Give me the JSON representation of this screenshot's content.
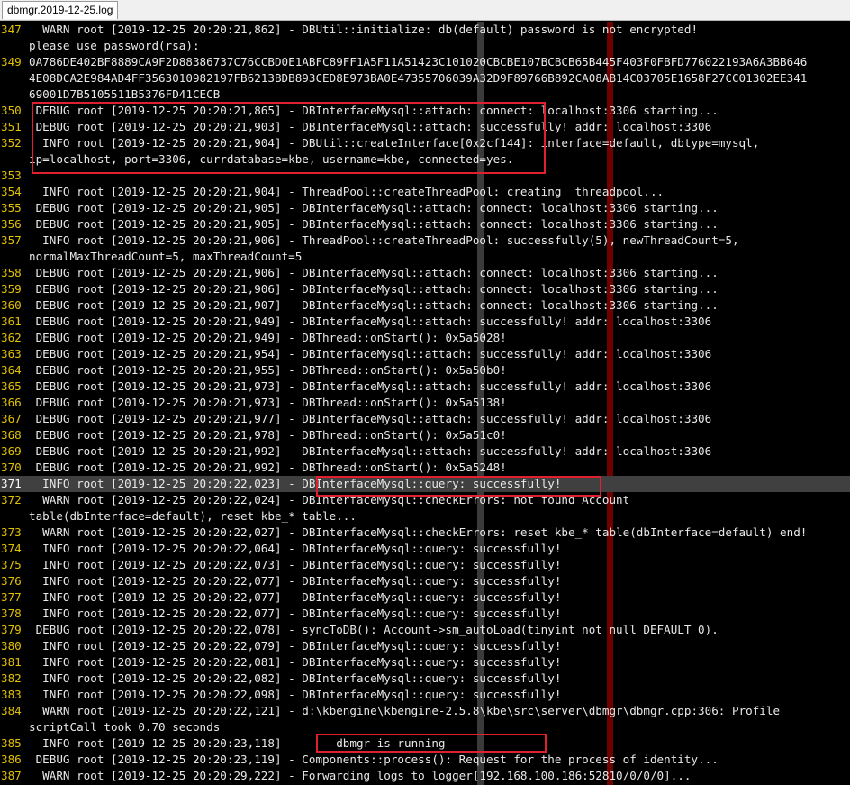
{
  "tab": {
    "title": "dbmgr.2019-12-25.log"
  },
  "lines": [
    {
      "no": "347",
      "text": "  WARN root [2019-12-25 20:20:21,862] - DBUtil::initialize: db(default) password is not encrypted!"
    },
    {
      "no": "",
      "text": "please use password(rsa):"
    },
    {
      "no": "349",
      "text": "0A786DE402BF8889CA9F2D88386737C76CCBD0E1ABFC89FF1A5F11A51423C101020CBCBE107BCBCB65B445F403F0FBFD776022193A6A3BB646"
    },
    {
      "no": "",
      "text": "4E08DCA2E984AD4FF3563010982197FB6213BDB893CED8E973BA0E47355706039A32D9F89766B892CA08AB14C03705E1658F27CC01302EE341"
    },
    {
      "no": "",
      "text": "69001D7B5105511B5376FD41CECB"
    },
    {
      "no": "350",
      "text": " DEBUG root [2019-12-25 20:20:21,865] - DBInterfaceMysql::attach: connect: localhost:3306 starting..."
    },
    {
      "no": "351",
      "text": " DEBUG root [2019-12-25 20:20:21,903] - DBInterfaceMysql::attach: successfully! addr: localhost:3306"
    },
    {
      "no": "352",
      "text": "  INFO root [2019-12-25 20:20:21,904] - DBUtil::createInterface[0x2cf144]: interface=default, dbtype=mysql,"
    },
    {
      "no": "",
      "text": "ip=localhost, port=3306, currdatabase=kbe, username=kbe, connected=yes."
    },
    {
      "no": "353",
      "text": ""
    },
    {
      "no": "354",
      "text": "  INFO root [2019-12-25 20:20:21,904] - ThreadPool::createThreadPool: creating  threadpool..."
    },
    {
      "no": "355",
      "text": " DEBUG root [2019-12-25 20:20:21,905] - DBInterfaceMysql::attach: connect: localhost:3306 starting..."
    },
    {
      "no": "356",
      "text": " DEBUG root [2019-12-25 20:20:21,905] - DBInterfaceMysql::attach: connect: localhost:3306 starting..."
    },
    {
      "no": "357",
      "text": "  INFO root [2019-12-25 20:20:21,906] - ThreadPool::createThreadPool: successfully(5), newThreadCount=5,"
    },
    {
      "no": "",
      "text": "normalMaxThreadCount=5, maxThreadCount=5"
    },
    {
      "no": "358",
      "text": " DEBUG root [2019-12-25 20:20:21,906] - DBInterfaceMysql::attach: connect: localhost:3306 starting..."
    },
    {
      "no": "359",
      "text": " DEBUG root [2019-12-25 20:20:21,906] - DBInterfaceMysql::attach: connect: localhost:3306 starting..."
    },
    {
      "no": "360",
      "text": " DEBUG root [2019-12-25 20:20:21,907] - DBInterfaceMysql::attach: connect: localhost:3306 starting..."
    },
    {
      "no": "361",
      "text": " DEBUG root [2019-12-25 20:20:21,949] - DBInterfaceMysql::attach: successfully! addr: localhost:3306"
    },
    {
      "no": "362",
      "text": " DEBUG root [2019-12-25 20:20:21,949] - DBThread::onStart(): 0x5a5028!"
    },
    {
      "no": "363",
      "text": " DEBUG root [2019-12-25 20:20:21,954] - DBInterfaceMysql::attach: successfully! addr: localhost:3306"
    },
    {
      "no": "364",
      "text": " DEBUG root [2019-12-25 20:20:21,955] - DBThread::onStart(): 0x5a50b0!"
    },
    {
      "no": "365",
      "text": " DEBUG root [2019-12-25 20:20:21,973] - DBInterfaceMysql::attach: successfully! addr: localhost:3306"
    },
    {
      "no": "366",
      "text": " DEBUG root [2019-12-25 20:20:21,973] - DBThread::onStart(): 0x5a5138!"
    },
    {
      "no": "367",
      "text": " DEBUG root [2019-12-25 20:20:21,977] - DBInterfaceMysql::attach: successfully! addr: localhost:3306"
    },
    {
      "no": "368",
      "text": " DEBUG root [2019-12-25 20:20:21,978] - DBThread::onStart(): 0x5a51c0!"
    },
    {
      "no": "369",
      "text": " DEBUG root [2019-12-25 20:20:21,992] - DBInterfaceMysql::attach: successfully! addr: localhost:3306"
    },
    {
      "no": "370",
      "text": " DEBUG root [2019-12-25 20:20:21,992] - DBThread::onStart(): 0x5a5248!"
    },
    {
      "no": "371",
      "text": "  INFO root [2019-12-25 20:20:22,023] - DBInterfaceMysql::query: successfully!",
      "current": true
    },
    {
      "no": "372",
      "text": "  WARN root [2019-12-25 20:20:22,024] - DBInterfaceMysql::checkErrors: not found Account"
    },
    {
      "no": "",
      "text": "table(dbInterface=default), reset kbe_* table..."
    },
    {
      "no": "373",
      "text": "  WARN root [2019-12-25 20:20:22,027] - DBInterfaceMysql::checkErrors: reset kbe_* table(dbInterface=default) end!"
    },
    {
      "no": "374",
      "text": "  INFO root [2019-12-25 20:20:22,064] - DBInterfaceMysql::query: successfully!"
    },
    {
      "no": "375",
      "text": "  INFO root [2019-12-25 20:20:22,073] - DBInterfaceMysql::query: successfully!"
    },
    {
      "no": "376",
      "text": "  INFO root [2019-12-25 20:20:22,077] - DBInterfaceMysql::query: successfully!"
    },
    {
      "no": "377",
      "text": "  INFO root [2019-12-25 20:20:22,077] - DBInterfaceMysql::query: successfully!"
    },
    {
      "no": "378",
      "text": "  INFO root [2019-12-25 20:20:22,077] - DBInterfaceMysql::query: successfully!"
    },
    {
      "no": "379",
      "text": " DEBUG root [2019-12-25 20:20:22,078] - syncToDB(): Account->sm_autoLoad(tinyint not null DEFAULT 0)."
    },
    {
      "no": "380",
      "text": "  INFO root [2019-12-25 20:20:22,079] - DBInterfaceMysql::query: successfully!"
    },
    {
      "no": "381",
      "text": "  INFO root [2019-12-25 20:20:22,081] - DBInterfaceMysql::query: successfully!"
    },
    {
      "no": "382",
      "text": "  INFO root [2019-12-25 20:20:22,082] - DBInterfaceMysql::query: successfully!"
    },
    {
      "no": "383",
      "text": "  INFO root [2019-12-25 20:20:22,098] - DBInterfaceMysql::query: successfully!"
    },
    {
      "no": "384",
      "text": "  WARN root [2019-12-25 20:20:22,121] - d:\\kbengine\\kbengine-2.5.8\\kbe\\src\\server\\dbmgr\\dbmgr.cpp:306: Profile"
    },
    {
      "no": "",
      "text": "scriptCall took 0.70 seconds"
    },
    {
      "no": "385",
      "text": "  INFO root [2019-12-25 20:20:23,118] - ---- dbmgr is running ----"
    },
    {
      "no": "386",
      "text": " DEBUG root [2019-12-25 20:20:23,119] - Components::process(): Request for the process of identity..."
    },
    {
      "no": "387",
      "text": "  WARN root [2019-12-25 20:20:29,222] - Forwarding logs to logger[192.168.100.186:52810/0/0/0]..."
    }
  ]
}
